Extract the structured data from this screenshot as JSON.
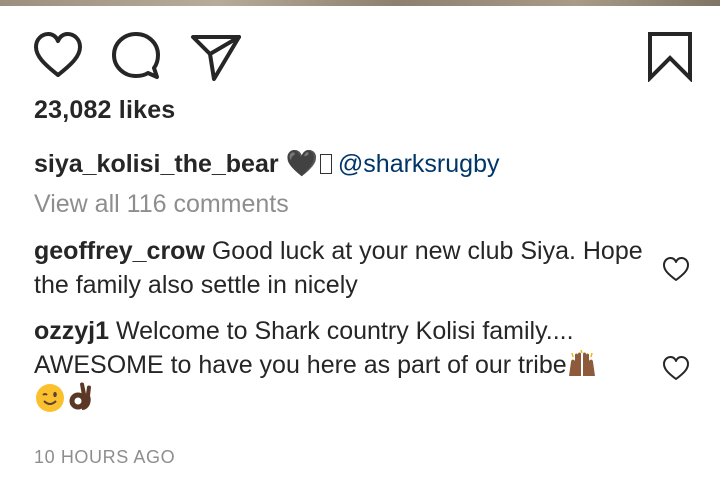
{
  "post": {
    "likes": "23,082 likes",
    "caption": {
      "username": "siya_kolisi_the_bear",
      "emoji": "🖤",
      "mention": "@sharksrugby"
    },
    "view_comments": "View all 116 comments",
    "comments": [
      {
        "username": "geoffrey_crow",
        "text": "Good luck at your new club Siya. Hope the family also settle in nicely"
      },
      {
        "username": "ozzyj1",
        "text": "Welcome to Shark country Kolisi family.... AWESOME to have you here as part of our tribe",
        "trailing_emojis": [
          "raised-hands-emoji",
          "wink-emoji",
          "ok-hand-emoji"
        ]
      }
    ],
    "timestamp": "10 HOURS AGO"
  },
  "icons": {
    "like": "heart-icon",
    "comment": "comment-bubble-icon",
    "share": "paper-plane-icon",
    "save": "bookmark-icon"
  },
  "colors": {
    "text": "#262626",
    "secondary": "#8e8e8e",
    "mention": "#003569"
  }
}
